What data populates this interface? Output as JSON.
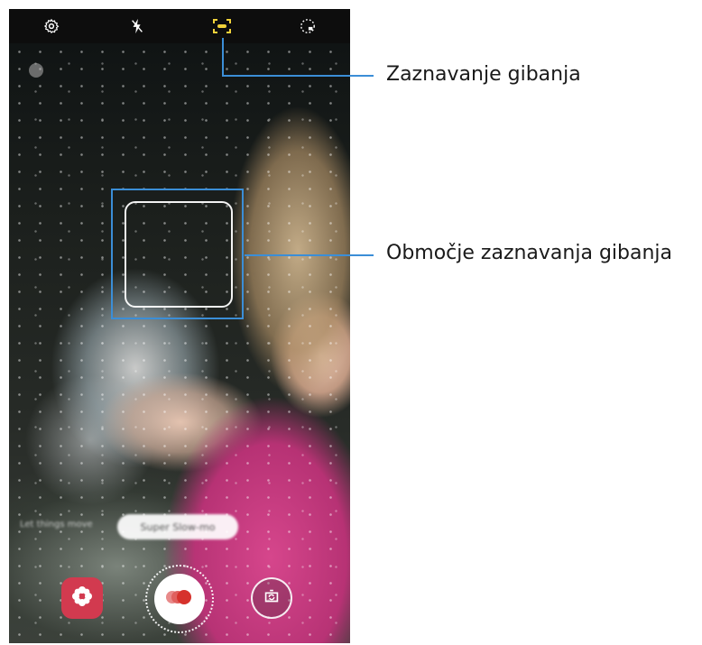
{
  "callouts": {
    "motion_detection": "Zaznavanje gibanja",
    "motion_detection_area": "Območje zaznavanja gibanja"
  },
  "top_bar": {
    "icons": [
      "settings-icon",
      "flash-off-icon",
      "motion-detection-icon",
      "timer-icon"
    ]
  },
  "viewfinder": {
    "mode_pill_label": "Super Slow-mo",
    "hint_text": "Let things move"
  },
  "bottom_controls": {
    "icons": [
      "bixby-vision-icon",
      "record-icon",
      "switch-camera-icon"
    ]
  },
  "colors": {
    "accent_blue": "#3b8ed7",
    "bixby_red": "#d23a4f",
    "record_red": "#d6322c"
  }
}
